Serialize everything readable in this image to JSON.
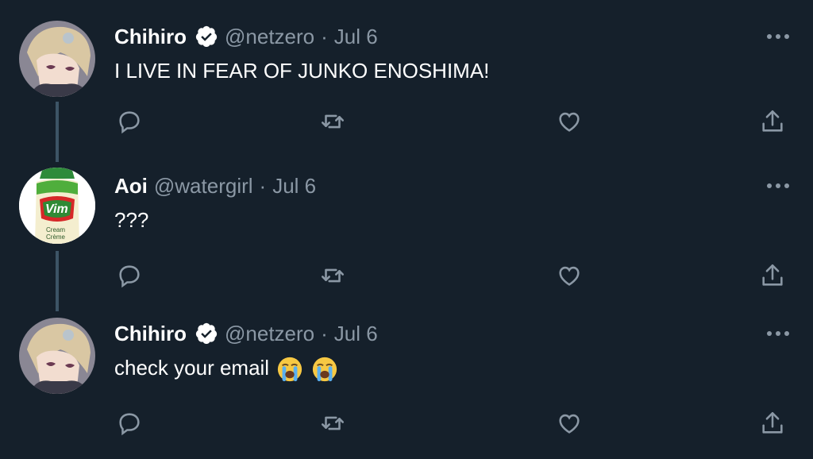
{
  "colors": {
    "background": "#15202b",
    "text_primary": "#ffffff",
    "text_secondary": "#8b98a5",
    "thread_line": "#3d5466",
    "verified": "#ffffff"
  },
  "tweets": [
    {
      "name": "Chihiro",
      "verified": true,
      "handle": "@netzero",
      "separator": "·",
      "date": "Jul 6",
      "text": "I LIVE IN FEAR OF JUNKO ENOSHIMA!",
      "avatar": "anime-boy-avatar",
      "actions": [
        "reply-icon",
        "retweet-icon",
        "like-icon",
        "share-icon"
      ]
    },
    {
      "name": "Aoi",
      "verified": false,
      "handle": "@watergirl",
      "separator": "·",
      "date": "Jul 6",
      "text": "???",
      "avatar": "vim-cream-bottle-avatar",
      "avatar_text": {
        "brand": "Vim",
        "line1": "Cream",
        "line2": "Crème"
      },
      "actions": [
        "reply-icon",
        "retweet-icon",
        "like-icon",
        "share-icon"
      ]
    },
    {
      "name": "Chihiro",
      "verified": true,
      "handle": "@netzero",
      "separator": "·",
      "date": "Jul 6",
      "text": "check your email",
      "emojis": [
        "crying-face-emoji",
        "crying-face-emoji"
      ],
      "avatar": "anime-boy-avatar",
      "actions": [
        "reply-icon",
        "retweet-icon",
        "like-icon",
        "share-icon"
      ]
    }
  ]
}
